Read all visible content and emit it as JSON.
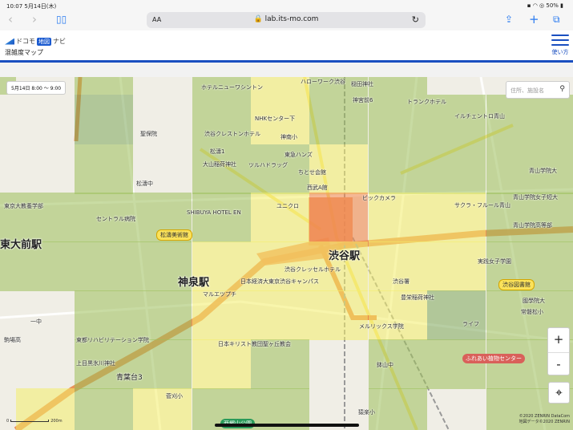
{
  "status_bar": {
    "time": "10:07",
    "date": "5月14日(木)",
    "battery": "50%"
  },
  "browser": {
    "text_size": "AA",
    "url": "lab.its-mo.com"
  },
  "header": {
    "logo_text_left": "ドコモ",
    "logo_box": "地図",
    "logo_text_right": "ナビ",
    "subtitle": "混雑度マップ",
    "menu_label": "使い方"
  },
  "map": {
    "date_range": "5月14日 8:00 ～ 9:00",
    "search_placeholder": "住所、施設名",
    "zoom_in": "+",
    "zoom_out": "-",
    "scale": "200m",
    "copyright_1": "©2020 ZENRIN DataCom",
    "copyright_2": "地図データ©2020 ZENRIN",
    "congestion_colors": {
      "0": "transparent",
      "1": "#9cc05a",
      "2": "#f4ee6a",
      "3": "#f08a50",
      "4": "#7da85a"
    },
    "congestion_grid": [
      [
        1,
        0,
        1,
        0,
        1,
        2,
        1,
        1,
        0,
        0,
        0
      ],
      [
        0,
        0,
        4,
        0,
        1,
        2,
        1,
        1,
        1,
        1,
        1
      ],
      [
        0,
        0,
        1,
        0,
        1,
        1,
        2,
        1,
        1,
        1,
        1
      ],
      [
        1,
        1,
        1,
        1,
        1,
        2,
        3,
        2,
        2,
        1,
        1
      ],
      [
        1,
        1,
        1,
        1,
        2,
        2,
        2,
        2,
        2,
        1,
        1
      ],
      [
        0,
        0,
        1,
        1,
        2,
        2,
        2,
        2,
        4,
        1,
        1
      ],
      [
        0,
        0,
        1,
        1,
        2,
        1,
        0,
        1,
        1,
        1,
        1
      ],
      [
        0,
        2,
        1,
        2,
        1,
        1,
        0,
        1,
        0,
        1,
        1
      ]
    ],
    "labels": [
      "ホテルニューワシントン",
      "ハローワーク渋谷",
      "穏田神社",
      "神宮前6",
      "トランクホテル",
      "NHKセンター下",
      "渋谷クレストンホテル",
      "神南小",
      "イルチェントロ青山",
      "聖保院",
      "大山稲荷神社",
      "ツルハドラッグ",
      "東急ハンズ",
      "ちとせ会館",
      "松濤中",
      "松濤1",
      "西武A館",
      "ビックカメラ",
      "青山学院大",
      "青山学院女子短大",
      "青山学院高等部",
      "サクラ・フルール青山",
      "SHIBUYA HOTEL EN",
      "ユニクロ",
      "東京大教養学部",
      "セントラル病院",
      "東大前駅",
      "渋谷駅",
      "神泉駅",
      "日本経済大東京渋谷キャンパス",
      "渋谷クレッセルホテル",
      "実践女子学園",
      "國學院大",
      "常磐松小",
      "メルリックス学院",
      "東都リハビリテーション学院",
      "日本キリスト教団聖ヶ丘教会",
      "上目黒氷川神社",
      "鉢山中",
      "青葉台3",
      "菅刈小",
      "猿楽小",
      "ライフ",
      "駒場高",
      "マルエツプチ",
      "渋谷署",
      "豊栄稲荷神社",
      "一中"
    ],
    "pills": {
      "museum": "松濤美術館",
      "library": "渋谷図書館",
      "botanical": "ふれあい植物センター",
      "park": "西郷山公園"
    }
  }
}
